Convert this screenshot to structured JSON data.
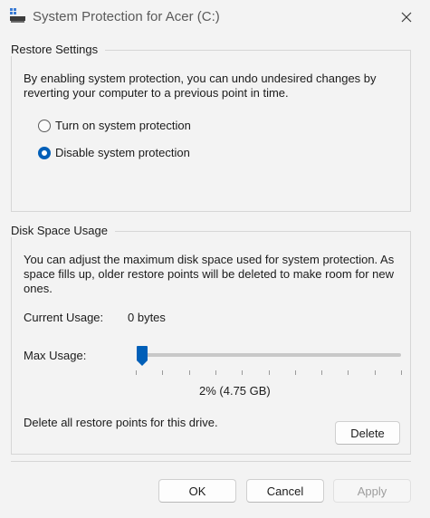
{
  "window": {
    "title": "System Protection for Acer (C:)"
  },
  "restore_settings": {
    "group_label": "Restore Settings",
    "description": "By enabling system protection, you can undo undesired changes by reverting your computer to a previous point in time.",
    "options": [
      {
        "label": "Turn on system protection",
        "checked": false
      },
      {
        "label": "Disable system protection",
        "checked": true
      }
    ]
  },
  "disk_space": {
    "group_label": "Disk Space Usage",
    "description": "You can adjust the maximum disk space used for system protection. As space fills up, older restore points will be deleted to make room for new ones.",
    "current_usage_label": "Current Usage:",
    "current_usage_value": "0 bytes",
    "max_usage_label": "Max Usage:",
    "max_usage_fraction": 0.02,
    "max_usage_value": "2% (4.75 GB)",
    "delete_text": "Delete all restore points for this drive.",
    "delete_label": "Delete"
  },
  "footer": {
    "ok_label": "OK",
    "cancel_label": "Cancel",
    "apply_label": "Apply"
  },
  "colors": {
    "accent": "#005fb8"
  }
}
